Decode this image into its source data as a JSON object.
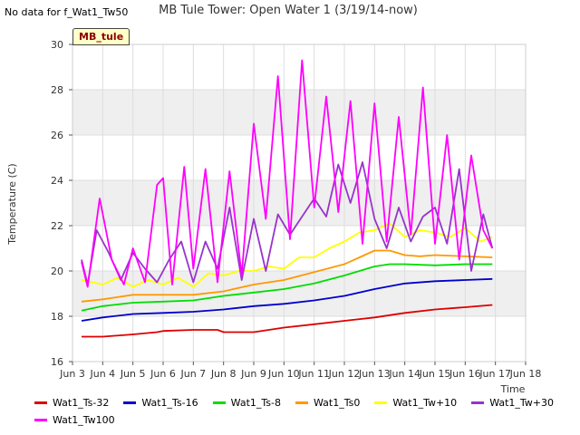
{
  "header": {
    "nodata_text": "No data for f_Wat1_Tw50",
    "site_tag": "MB_tule"
  },
  "chart_data": {
    "type": "line",
    "title": "MB Tule Tower: Open Water 1 (3/19/14-now)",
    "xlabel": "Time",
    "ylabel": "Temperature (C)",
    "xlim": [
      3,
      18
    ],
    "ylim": [
      16,
      30
    ],
    "x_ticks": [
      {
        "value": 3,
        "label": "Jun 3"
      },
      {
        "value": 4,
        "label": "Jun 4"
      },
      {
        "value": 5,
        "label": "Jun 5"
      },
      {
        "value": 6,
        "label": "Jun 6"
      },
      {
        "value": 7,
        "label": "Jun 7"
      },
      {
        "value": 8,
        "label": "Jun 8"
      },
      {
        "value": 9,
        "label": "Jun 9"
      },
      {
        "value": 10,
        "label": "Jun 10"
      },
      {
        "value": 11,
        "label": "Jun 11"
      },
      {
        "value": 12,
        "label": "Jun 12"
      },
      {
        "value": 13,
        "label": "Jun 13"
      },
      {
        "value": 14,
        "label": "Jun 14"
      },
      {
        "value": 15,
        "label": "Jun 15"
      },
      {
        "value": 16,
        "label": "Jun 16"
      },
      {
        "value": 17,
        "label": "Jun 17"
      },
      {
        "value": 18,
        "label": "Jun 18"
      }
    ],
    "y_ticks": [
      16,
      18,
      20,
      22,
      24,
      26,
      28,
      30
    ],
    "grid": true,
    "legend_position": "bottom",
    "series": [
      {
        "name": "Wat1_Ts-32",
        "color": "#dd0000",
        "x": [
          3.3,
          4,
          5,
          5.8,
          6,
          7,
          7.8,
          8,
          8.5,
          9,
          9.5,
          10,
          11,
          12,
          13,
          14,
          15,
          16,
          16.9
        ],
        "y": [
          17.1,
          17.1,
          17.2,
          17.3,
          17.35,
          17.4,
          17.4,
          17.3,
          17.3,
          17.3,
          17.4,
          17.5,
          17.65,
          17.8,
          17.95,
          18.15,
          18.3,
          18.4,
          18.5
        ]
      },
      {
        "name": "Wat1_Ts-16",
        "color": "#0000cc",
        "x": [
          3.3,
          4,
          5,
          6,
          7,
          8,
          9,
          10,
          11,
          12,
          13,
          14,
          15,
          16,
          16.9
        ],
        "y": [
          17.8,
          17.95,
          18.1,
          18.15,
          18.2,
          18.3,
          18.45,
          18.55,
          18.7,
          18.9,
          19.2,
          19.45,
          19.55,
          19.6,
          19.65
        ]
      },
      {
        "name": "Wat1_Ts-8",
        "color": "#00dd00",
        "x": [
          3.3,
          4,
          5,
          6,
          7,
          8,
          9,
          10,
          11,
          12,
          13,
          13.5,
          14,
          15,
          16,
          16.9
        ],
        "y": [
          18.25,
          18.45,
          18.6,
          18.65,
          18.7,
          18.9,
          19.05,
          19.2,
          19.45,
          19.8,
          20.2,
          20.3,
          20.3,
          20.25,
          20.3,
          20.3
        ]
      },
      {
        "name": "Wat1_Ts0",
        "color": "#ff9900",
        "x": [
          3.3,
          4,
          5,
          6,
          7,
          8,
          9,
          10,
          11,
          12,
          12.5,
          13,
          13.5,
          14,
          14.5,
          15,
          16,
          16.9
        ],
        "y": [
          18.65,
          18.75,
          18.95,
          18.95,
          18.95,
          19.1,
          19.4,
          19.6,
          19.95,
          20.3,
          20.6,
          20.9,
          20.9,
          20.7,
          20.65,
          20.7,
          20.65,
          20.6
        ]
      },
      {
        "name": "Wat1_Tw+10",
        "color": "#ffff00",
        "x": [
          3.3,
          4,
          4.5,
          5,
          5.5,
          6,
          6.5,
          7,
          7.5,
          8,
          8.5,
          9,
          9.5,
          10,
          10.5,
          11,
          11.5,
          12,
          12.5,
          13,
          13.5,
          14,
          14.5,
          15,
          15.5,
          16,
          16.5,
          16.9
        ],
        "y": [
          19.6,
          19.4,
          19.7,
          19.3,
          19.6,
          19.4,
          19.7,
          19.3,
          19.9,
          19.8,
          20.0,
          20.0,
          20.2,
          20.1,
          20.6,
          20.6,
          21.0,
          21.3,
          21.7,
          21.8,
          22.1,
          21.5,
          21.8,
          21.7,
          21.5,
          21.9,
          21.3,
          21.5
        ]
      },
      {
        "name": "Wat1_Tw+30",
        "color": "#9933cc",
        "x": [
          3.3,
          3.5,
          3.8,
          4.2,
          4.6,
          5.0,
          5.4,
          5.8,
          6.2,
          6.6,
          7.0,
          7.4,
          7.8,
          8.2,
          8.6,
          9.0,
          9.4,
          9.8,
          10.2,
          10.6,
          11.0,
          11.4,
          11.8,
          12.2,
          12.6,
          13.0,
          13.4,
          13.8,
          14.2,
          14.6,
          15.0,
          15.4,
          15.8,
          16.2,
          16.6,
          16.9
        ],
        "y": [
          20.5,
          19.4,
          21.8,
          20.8,
          19.6,
          20.8,
          20.1,
          19.5,
          20.5,
          21.3,
          19.5,
          21.3,
          20.1,
          22.8,
          19.6,
          22.3,
          20.0,
          22.5,
          21.6,
          22.4,
          23.2,
          22.4,
          24.7,
          23.0,
          24.8,
          22.3,
          21.0,
          22.8,
          21.3,
          22.4,
          22.8,
          21.2,
          24.5,
          20.0,
          22.5,
          21.0
        ]
      },
      {
        "name": "Wat1_Tw100",
        "color": "#ff00ff",
        "x": [
          3.3,
          3.5,
          3.9,
          4.3,
          4.7,
          5.0,
          5.4,
          5.8,
          6.0,
          6.3,
          6.7,
          7.0,
          7.4,
          7.8,
          8.2,
          8.6,
          9.0,
          9.4,
          9.8,
          10.2,
          10.6,
          11.0,
          11.4,
          11.8,
          12.2,
          12.6,
          13.0,
          13.4,
          13.8,
          14.2,
          14.6,
          15.0,
          15.4,
          15.8,
          16.2,
          16.6,
          16.9
        ],
        "y": [
          20.4,
          19.3,
          23.2,
          20.5,
          19.4,
          21.0,
          19.5,
          23.8,
          24.1,
          19.4,
          24.6,
          20.1,
          24.5,
          19.5,
          24.4,
          19.8,
          26.5,
          22.3,
          28.6,
          21.4,
          29.3,
          22.8,
          27.7,
          22.6,
          27.5,
          21.2,
          27.4,
          21.3,
          26.8,
          21.6,
          28.1,
          21.2,
          26.0,
          20.5,
          25.1,
          21.8,
          21.0
        ]
      }
    ]
  }
}
